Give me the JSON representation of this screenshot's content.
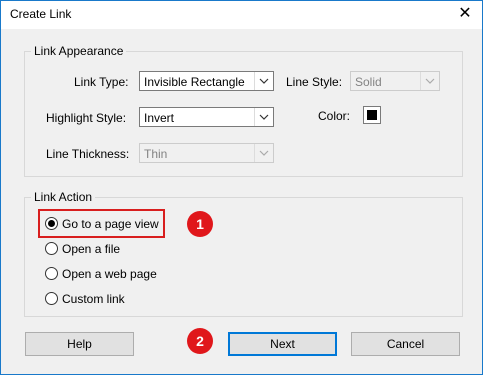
{
  "window": {
    "title": "Create Link",
    "close_glyph": "✕"
  },
  "appearance": {
    "legend": "Link Appearance",
    "link_type_label": "Link Type:",
    "link_type_value": "Invisible Rectangle",
    "line_style_label": "Line Style:",
    "line_style_value": "Solid",
    "highlight_label": "Highlight Style:",
    "highlight_value": "Invert",
    "color_label": "Color:",
    "color_value": "#000000",
    "thickness_label": "Line Thickness:",
    "thickness_value": "Thin"
  },
  "action": {
    "legend": "Link Action",
    "options": [
      "Go to a page view",
      "Open a file",
      "Open a web page",
      "Custom link"
    ],
    "selected_index": 0
  },
  "annotations": {
    "badge_1": "1",
    "badge_2": "2",
    "badge_color": "#e0171b"
  },
  "buttons": {
    "help": "Help",
    "next": "Next",
    "cancel": "Cancel"
  }
}
